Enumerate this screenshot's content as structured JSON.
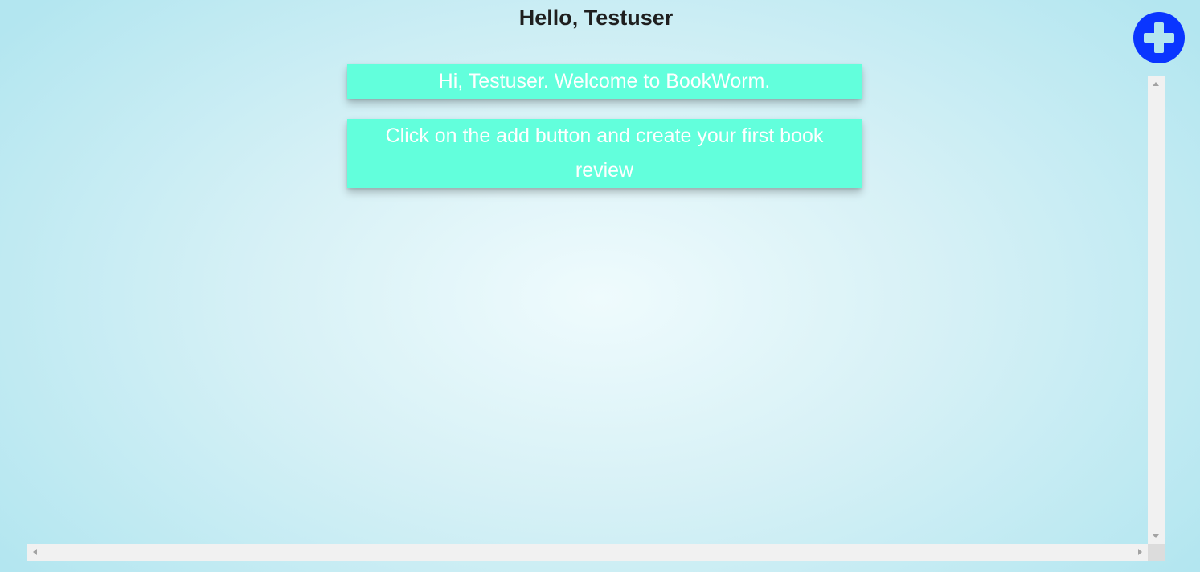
{
  "header": {
    "greeting": "Hello, Testuser"
  },
  "add_button": {
    "icon": "plus-icon",
    "color": "#0a35ff"
  },
  "messages": [
    {
      "text": "Hi, Testuser. Welcome to BookWorm."
    },
    {
      "text": "Click on the add button and create your first book review"
    }
  ],
  "colors": {
    "card_background": "#62ffdc",
    "card_text": "#ffffff",
    "heading_text": "#1f1f1f"
  },
  "scrollbars": {
    "vertical_icons": [
      "arrow-up-icon",
      "arrow-down-icon"
    ],
    "horizontal_icons": [
      "arrow-left-icon",
      "arrow-right-icon"
    ]
  }
}
